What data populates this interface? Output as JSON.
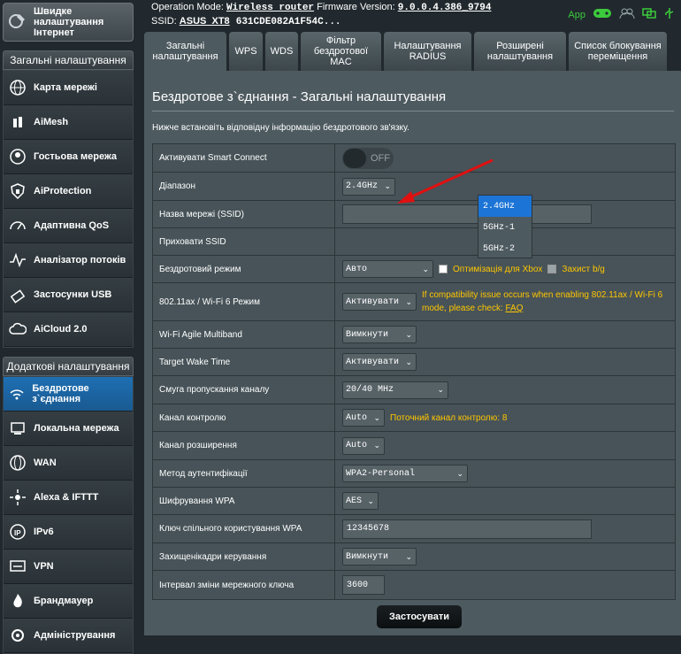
{
  "sidebar": {
    "qis_label": "Швидке налаштування Інтернет",
    "general_header": "Загальні налаштування",
    "general_items": [
      {
        "label": "Карта мережі",
        "icon": "globe-icon"
      },
      {
        "label": "AiMesh",
        "icon": "aimesh-icon"
      },
      {
        "label": "Гостьова мережа",
        "icon": "guest-network-icon"
      },
      {
        "label": "AiProtection",
        "icon": "shield-icon"
      },
      {
        "label": "Адаптивна QoS",
        "icon": "qos-gauge-icon"
      },
      {
        "label": "Аналізатор потоків",
        "icon": "traffic-analyzer-icon"
      },
      {
        "label": "Застосунки USB",
        "icon": "usb-icon"
      },
      {
        "label": "AiCloud 2.0",
        "icon": "cloud-icon"
      }
    ],
    "advanced_header": "Додаткові налаштування",
    "advanced_items": [
      {
        "label": "Бездротове з`єднання",
        "icon": "wireless-icon",
        "active": true
      },
      {
        "label": "Локальна мережа",
        "icon": "lan-icon"
      },
      {
        "label": "WAN",
        "icon": "wan-globe-icon"
      },
      {
        "label": "Alexa & IFTTT",
        "icon": "alexa-icon"
      },
      {
        "label": "IPv6",
        "icon": "ipv6-icon"
      },
      {
        "label": "VPN",
        "icon": "vpn-icon"
      },
      {
        "label": "Брандмауер",
        "icon": "firewall-icon"
      },
      {
        "label": "Адміністрування",
        "icon": "admin-icon"
      }
    ]
  },
  "header": {
    "op_mode_label": "Operation Mode:",
    "op_mode_value": "Wireless router",
    "firmware_label": "Firmware Version:",
    "firmware_value": "9.0.0.4.386_9794",
    "ssid_label": "SSID:",
    "ssid_value": "ASUS_XT8",
    "ssid_value2": "631CDE082A1F54C...",
    "app_label": "App"
  },
  "tabs": [
    {
      "label": "Загальні налаштування",
      "active": true
    },
    {
      "label": "WPS"
    },
    {
      "label": "WDS"
    },
    {
      "label": "Фільтр бездротової MAC"
    },
    {
      "label": "Налаштування RADIUS"
    },
    {
      "label": "Розширені налаштування"
    },
    {
      "label": "Список блокування переміщення"
    }
  ],
  "panel": {
    "title": "Бездротове з`єднання - Загальні налаштування",
    "description": "Нижче встановіть відповідну інформацію бездротового зв'язку.",
    "apply_label": "Застосувати"
  },
  "form": {
    "smart_connect": {
      "label": "Активувати Smart Connect",
      "state": "OFF"
    },
    "band": {
      "label": "Діапазон",
      "value": "2.4GHz"
    },
    "ssid": {
      "label": "Назва мережі (SSID)",
      "value": ""
    },
    "hide_ssid": {
      "label": "Приховати SSID"
    },
    "wireless_mode": {
      "label": "Бездротовий режим",
      "value": "Авто",
      "xbox_label": "Оптимізація для Xbox",
      "bg_label": "Захист b/g"
    },
    "ax_mode": {
      "label": "802.11ax / Wi-Fi 6 Режим",
      "value": "Активувати",
      "note": "If compatibility issue occurs when enabling 802.11ax / Wi-Fi 6 mode, please check:",
      "faq": "FAQ"
    },
    "agile": {
      "label": "Wi-Fi Agile Multiband",
      "value": "Вимкнути"
    },
    "twt": {
      "label": "Target Wake Time",
      "value": "Активувати"
    },
    "bandwidth": {
      "label": "Смуга пропускання каналу",
      "value": "20/40 MHz"
    },
    "control_channel": {
      "label": "Канал контролю",
      "value": "Auto",
      "note": "Поточний канал контролю: 8"
    },
    "ext_channel": {
      "label": "Канал розширення",
      "value": "Auto"
    },
    "auth": {
      "label": "Метод аутентифікації",
      "value": "WPA2-Personal"
    },
    "wpa_enc": {
      "label": "Шифрування WPA",
      "value": "AES"
    },
    "psk": {
      "label": "Ключ спільного користування WPA",
      "value": "12345678"
    },
    "pmf": {
      "label": "Захищенікадри керування",
      "value": "Вимкнути"
    },
    "rekey": {
      "label": "Інтервал зміни мережного ключа",
      "value": "3600"
    }
  },
  "band_dropdown": [
    "2.4GHz",
    "5GHz-1",
    "5GHz-2"
  ],
  "colors": {
    "accent": "#1c74d6",
    "note": "#ffc600",
    "arrow": "#e01010"
  }
}
